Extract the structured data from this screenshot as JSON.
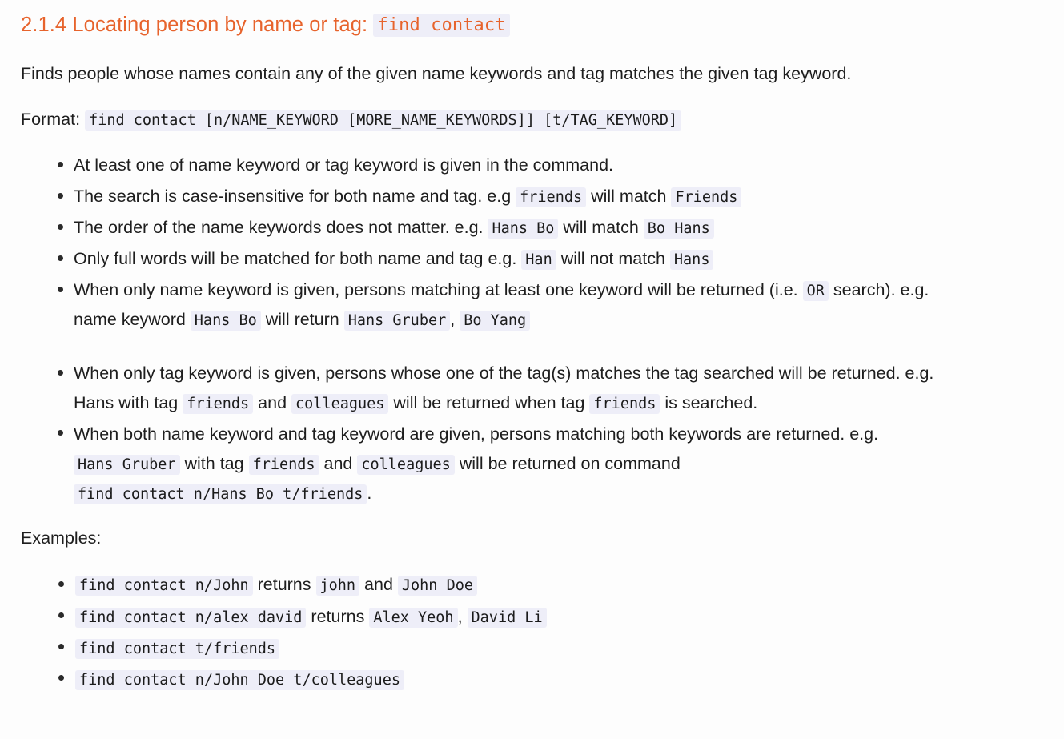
{
  "section": {
    "number": "2.1.4",
    "title_text": "2.1.4 Locating person by name or tag:",
    "title_code": "find contact"
  },
  "description": "Finds people whose names contain any of the given name keywords and tag matches the given tag keyword.",
  "format": {
    "label": "Format:",
    "code": "find contact [n/NAME_KEYWORD [MORE_NAME_KEYWORDS]] [t/TAG_KEYWORD]"
  },
  "rules": [
    {
      "id": "rule-at-least-one",
      "parts": [
        {
          "type": "text",
          "value": "At least one of name keyword or tag keyword is given in the command."
        }
      ]
    },
    {
      "id": "rule-case-insensitive",
      "parts": [
        {
          "type": "text",
          "value": "The search is case-insensitive for both name and tag. e.g "
        },
        {
          "type": "code",
          "value": "friends"
        },
        {
          "type": "text",
          "value": " will match "
        },
        {
          "type": "code",
          "value": "Friends"
        }
      ]
    },
    {
      "id": "rule-order-does-not-matter",
      "parts": [
        {
          "type": "text",
          "value": "The order of the name keywords does not matter. e.g. "
        },
        {
          "type": "code",
          "value": "Hans Bo"
        },
        {
          "type": "text",
          "value": " will match "
        },
        {
          "type": "code",
          "value": "Bo Hans"
        }
      ]
    },
    {
      "id": "rule-full-words-only",
      "parts": [
        {
          "type": "text",
          "value": "Only full words will be matched for both name and tag e.g. "
        },
        {
          "type": "code",
          "value": "Han"
        },
        {
          "type": "text",
          "value": " will not match "
        },
        {
          "type": "code",
          "value": "Hans"
        }
      ]
    },
    {
      "id": "rule-name-keyword-only",
      "parts": [
        {
          "type": "text",
          "value": "When only name keyword is given, persons matching at least one keyword will be returned (i.e. "
        },
        {
          "type": "code",
          "value": "OR"
        },
        {
          "type": "text",
          "value": " search). e.g. name keyword "
        },
        {
          "type": "code",
          "value": "Hans Bo"
        },
        {
          "type": "text",
          "value": " will return "
        },
        {
          "type": "code",
          "value": "Hans Gruber"
        },
        {
          "type": "text",
          "value": ", "
        },
        {
          "type": "code",
          "value": "Bo Yang"
        }
      ]
    },
    {
      "id": "rule-tag-keyword-only",
      "spaced": true,
      "parts": [
        {
          "type": "text",
          "value": "When only tag keyword is given, persons whose one of the tag(s) matches the tag searched will be returned. e.g. Hans with tag "
        },
        {
          "type": "code",
          "value": "friends"
        },
        {
          "type": "text",
          "value": " and "
        },
        {
          "type": "code",
          "value": "colleagues"
        },
        {
          "type": "text",
          "value": " will be returned when tag "
        },
        {
          "type": "code",
          "value": "friends"
        },
        {
          "type": "text",
          "value": " is searched."
        }
      ]
    },
    {
      "id": "rule-both-keywords",
      "parts": [
        {
          "type": "text",
          "value": "When both name keyword and tag keyword are given, persons matching both keywords are returned. e.g. "
        },
        {
          "type": "code",
          "value": "Hans Gruber"
        },
        {
          "type": "text",
          "value": " with tag "
        },
        {
          "type": "code",
          "value": "friends"
        },
        {
          "type": "text",
          "value": " and "
        },
        {
          "type": "code",
          "value": "colleagues"
        },
        {
          "type": "text",
          "value": " will be returned on command "
        },
        {
          "type": "code",
          "value": "find contact n/Hans Bo t/friends"
        },
        {
          "type": "text",
          "value": "."
        }
      ]
    }
  ],
  "examples_label": "Examples:",
  "examples": [
    {
      "id": "example-find-john",
      "parts": [
        {
          "type": "code",
          "value": "find contact n/John"
        },
        {
          "type": "text",
          "value": " returns "
        },
        {
          "type": "code",
          "value": "john"
        },
        {
          "type": "text",
          "value": " and "
        },
        {
          "type": "code",
          "value": "John Doe"
        }
      ]
    },
    {
      "id": "example-find-alex-david",
      "parts": [
        {
          "type": "code",
          "value": "find contact n/alex david"
        },
        {
          "type": "text",
          "value": " returns "
        },
        {
          "type": "code",
          "value": "Alex Yeoh"
        },
        {
          "type": "text",
          "value": ", "
        },
        {
          "type": "code",
          "value": "David Li"
        }
      ]
    },
    {
      "id": "example-find-tag-friends",
      "parts": [
        {
          "type": "code",
          "value": "find contact t/friends"
        }
      ]
    },
    {
      "id": "example-find-john-doe-colleagues",
      "parts": [
        {
          "type": "code",
          "value": "find contact n/John Doe t/colleagues"
        }
      ]
    }
  ],
  "colors": {
    "heading": "#e7632c",
    "code_bg": "#eeeef8",
    "text": "#1e1e1e",
    "page_bg": "#fdfdfd"
  }
}
